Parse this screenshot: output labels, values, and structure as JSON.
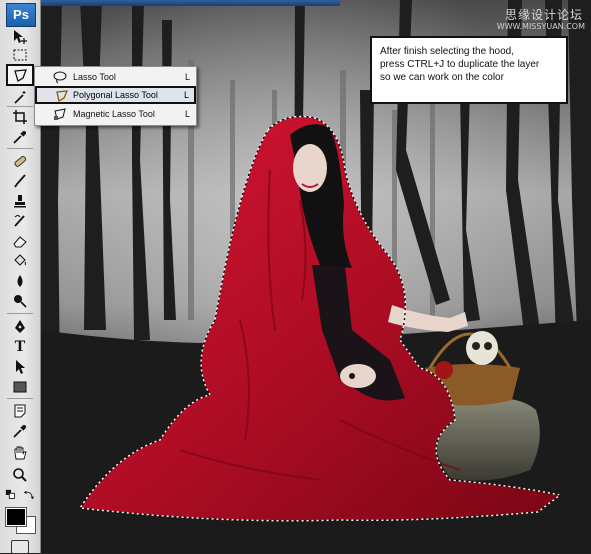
{
  "app": {
    "logo": "Ps"
  },
  "watermark": {
    "text": "思缘设计论坛",
    "url": "WWW.MISSYUAN.COM"
  },
  "toolbox": {
    "tools": [
      {
        "name": "move-tool",
        "icon": "move-icon"
      },
      {
        "name": "marquee-tool",
        "icon": "marquee-icon"
      },
      {
        "name": "lasso-tool",
        "icon": "polygonal-lasso-icon"
      },
      {
        "name": "quick-select-tool",
        "icon": "magic-wand-icon"
      },
      {
        "name": "crop-tool",
        "icon": "crop-icon"
      },
      {
        "name": "eyedropper-tool",
        "icon": "eyedropper-icon"
      },
      {
        "name": "healing-tool",
        "icon": "bandage-icon"
      },
      {
        "name": "brush-tool",
        "icon": "brush-icon"
      },
      {
        "name": "clone-stamp-tool",
        "icon": "stamp-icon"
      },
      {
        "name": "history-brush-tool",
        "icon": "history-brush-icon"
      },
      {
        "name": "eraser-tool",
        "icon": "eraser-icon"
      },
      {
        "name": "paint-bucket-tool",
        "icon": "bucket-icon"
      },
      {
        "name": "blur-tool",
        "icon": "drop-icon"
      },
      {
        "name": "dodge-tool",
        "icon": "dodge-icon"
      },
      {
        "name": "pen-tool",
        "icon": "pen-icon"
      },
      {
        "name": "type-tool",
        "icon": "type-icon"
      },
      {
        "name": "path-select-tool",
        "icon": "arrow-icon"
      },
      {
        "name": "shape-tool",
        "icon": "rectangle-icon"
      },
      {
        "name": "notes-tool",
        "icon": "note-icon"
      },
      {
        "name": "eyedropper-3d-tool",
        "icon": "eyedropper-icon"
      },
      {
        "name": "hand-tool",
        "icon": "hand-icon"
      },
      {
        "name": "zoom-tool",
        "icon": "zoom-icon"
      }
    ],
    "type_glyph": "T",
    "foreground_color": "#000000",
    "background_color": "#ffffff"
  },
  "flyout": {
    "items": [
      {
        "label": "Lasso Tool",
        "shortcut": "L",
        "icon": "lasso-icon",
        "selected": false
      },
      {
        "label": "Polygonal Lasso Tool",
        "shortcut": "L",
        "icon": "polygonal-lasso-icon",
        "selected": true
      },
      {
        "label": "Magnetic Lasso Tool",
        "shortcut": "L",
        "icon": "magnetic-lasso-icon",
        "selected": false
      }
    ]
  },
  "note": {
    "lines": [
      "After finish selecting the hood,",
      "press CTRL+J  to duplicate the layer",
      "so we can work on the color"
    ]
  },
  "colors": {
    "cloak_red": "#c0102a",
    "fog": "#9a9a9a",
    "selection": "#ffffff",
    "toolbar_bg": "#dcdcdc"
  }
}
